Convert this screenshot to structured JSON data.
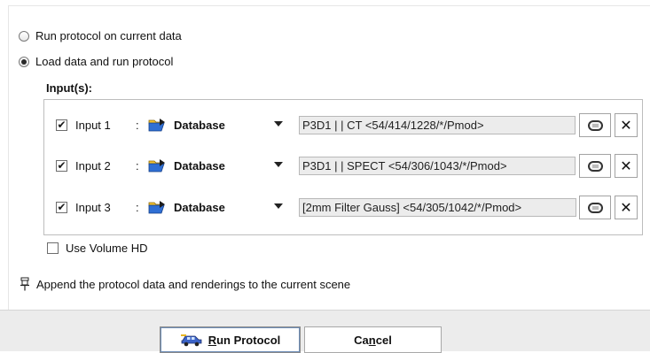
{
  "options": {
    "run_current": "Run protocol on current data",
    "load_and_run": "Load data and run protocol"
  },
  "selected_option": "load_and_run",
  "inputs_label": "Input(s):",
  "inputs": [
    {
      "label": "Input 1",
      "checked": true,
      "source": "Database",
      "value": "P3D1 |  | CT <54/414/1228/*/Pmod>"
    },
    {
      "label": "Input 2",
      "checked": true,
      "source": "Database",
      "value": "P3D1 |  | SPECT <54/306/1043/*/Pmod>"
    },
    {
      "label": "Input 3",
      "checked": true,
      "source": "Database",
      "value": "[2mm Filter Gauss] <54/305/1042/*/Pmod>"
    }
  ],
  "colon": ":",
  "close_glyph": "✕",
  "use_volume_hd": {
    "label": "Use Volume HD",
    "checked": false
  },
  "append_note": "Append the protocol data and renderings to the current scene",
  "buttons": {
    "run_prefix": "R",
    "run_rest": "un Protocol",
    "cancel_prefix": "Ca",
    "cancel_mnemonic": "n",
    "cancel_rest": "cel"
  },
  "icons": {
    "folder": "open-folder-icon",
    "dropdown": "triangle-down-icon",
    "pill": "capsule-icon",
    "close": "close-icon",
    "pin": "pin-icon",
    "run": "car-icon"
  },
  "colors": {
    "folder_blue": "#2f6fd4",
    "folder_yellow": "#f2c12e",
    "footer_bg": "#ececec"
  }
}
